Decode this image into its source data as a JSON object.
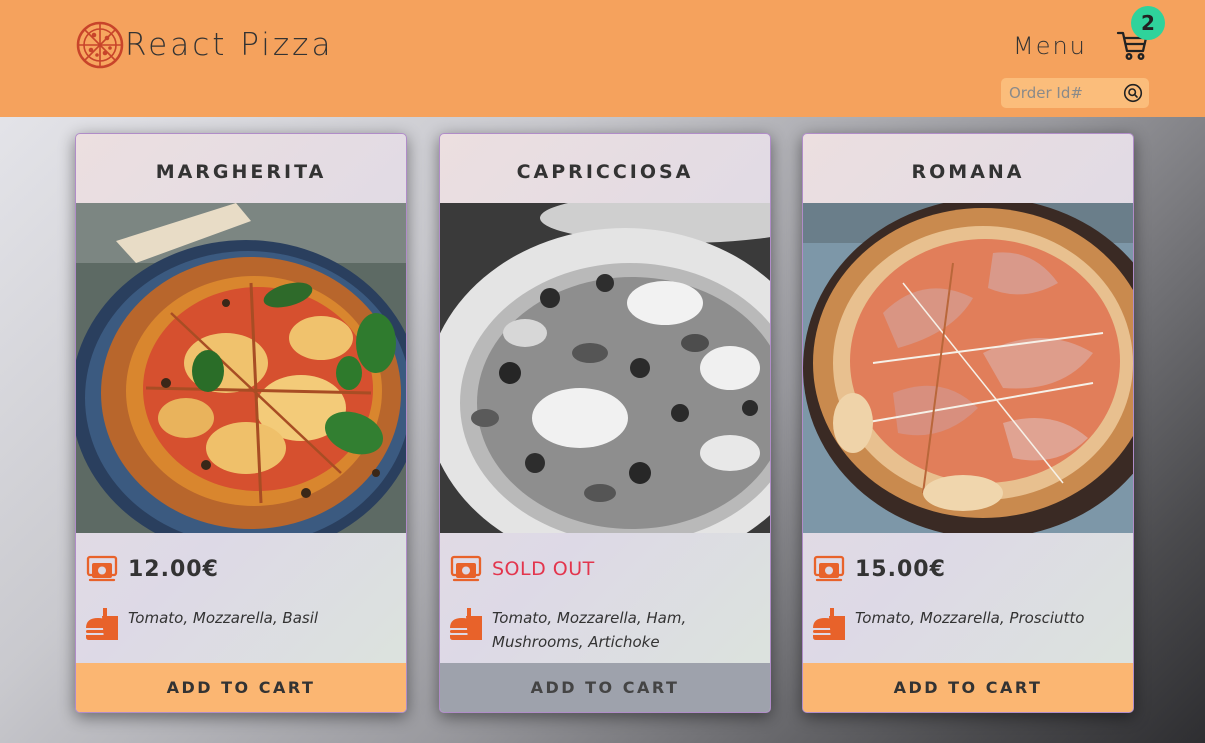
{
  "header": {
    "logo_icon": "pizza-icon",
    "app_name": "React Pizza",
    "menu_label": "Menu",
    "cart_icon": "cart-icon",
    "cart_count": "2",
    "search": {
      "placeholder": "Order Id#",
      "value": "",
      "icon": "search-icon"
    }
  },
  "colors": {
    "header_bg": "#f5a25d",
    "badge_bg": "#2fd39b",
    "button_bg": "#fbb672",
    "button_disabled_bg": "#9ea2ac",
    "sold_out": "#e3354d",
    "icon_accent": "#e8622a"
  },
  "pizzas": [
    {
      "name": "MARGHERITA",
      "price": "12.00€",
      "sold_out": false,
      "ingredients": "Tomato, Mozzarella, Basil",
      "button_label": "ADD TO CART"
    },
    {
      "name": "CAPRICCIOSA",
      "price": "SOLD OUT",
      "sold_out": true,
      "ingredients": "Tomato, Mozzarella, Ham, Mushrooms, Artichoke",
      "button_label": "ADD TO CART"
    },
    {
      "name": "ROMANA",
      "price": "15.00€",
      "sold_out": false,
      "ingredients": "Tomato, Mozzarella, Prosciutto",
      "button_label": "ADD TO CART"
    }
  ]
}
